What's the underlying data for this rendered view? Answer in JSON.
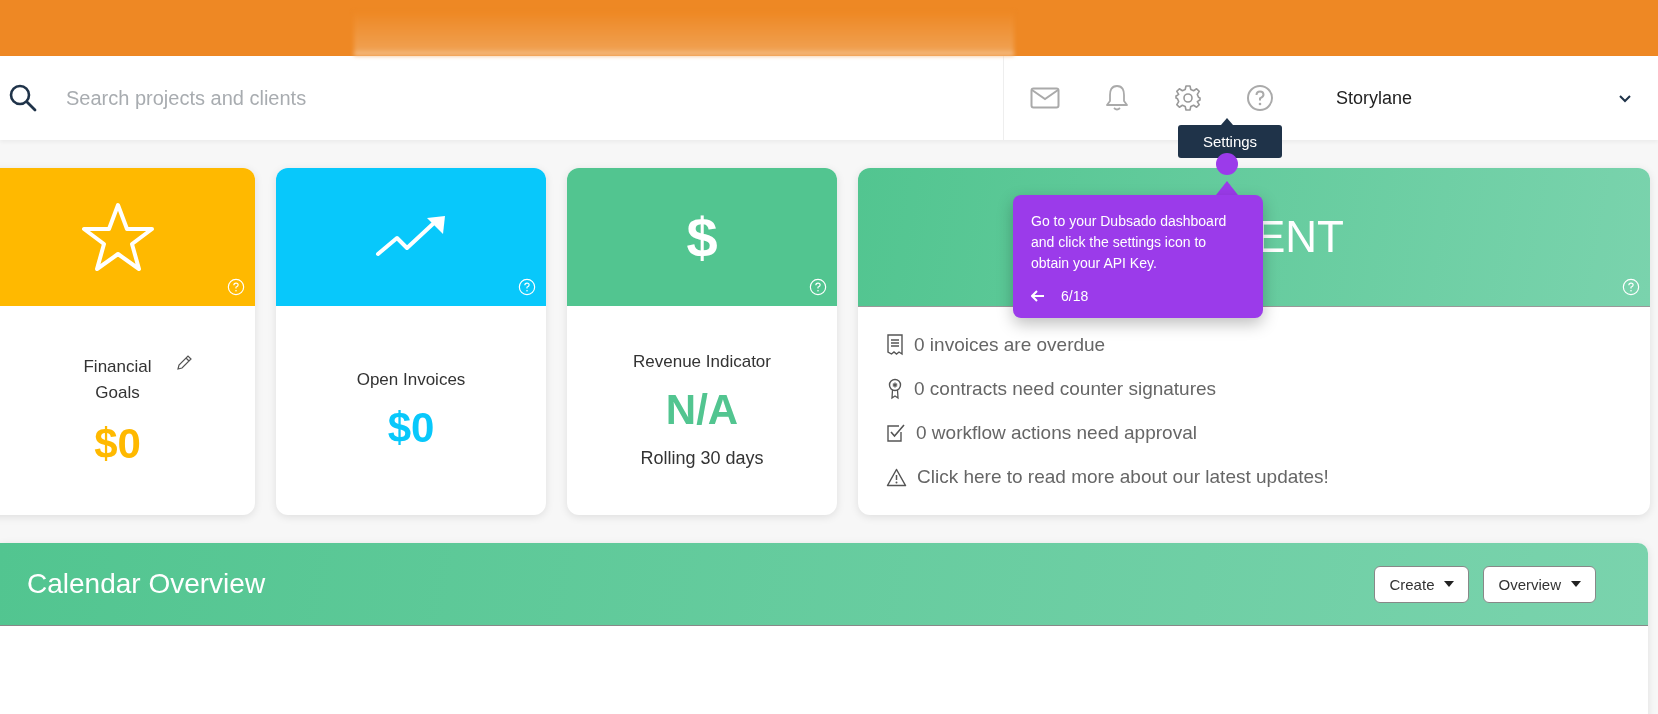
{
  "search": {
    "placeholder": "Search projects and clients"
  },
  "account": {
    "name": "Storylane"
  },
  "tooltip": {
    "label": "Settings"
  },
  "cards": [
    {
      "kind": "star",
      "title": "Financial Goals",
      "value": "$0",
      "color": "#ffb900",
      "editable": true
    },
    {
      "kind": "trend",
      "title": "Open Invoices",
      "value": "$0",
      "color": "#08c8fb"
    },
    {
      "kind": "symbol",
      "symbol": "$",
      "title": "Revenue Indicator",
      "value": "N/A",
      "note": "Rolling 30 days",
      "color": "#52c590"
    }
  ],
  "status_card": {
    "heading": "ENT",
    "items": [
      {
        "kind": "receipt",
        "text": "0 invoices are overdue"
      },
      {
        "kind": "ribbon",
        "text": "0 contracts need counter signatures"
      },
      {
        "kind": "check",
        "text": "0 workflow actions need approval"
      },
      {
        "kind": "warning",
        "text": "Click here to read more about our latest updates!"
      }
    ]
  },
  "guide": {
    "text": "Go to your Dubsado dashboard and click the settings icon to obtain your API Key.",
    "step": "6/18"
  },
  "calendar": {
    "title": "Calendar Overview",
    "buttons": [
      "Create",
      "Overview"
    ]
  }
}
